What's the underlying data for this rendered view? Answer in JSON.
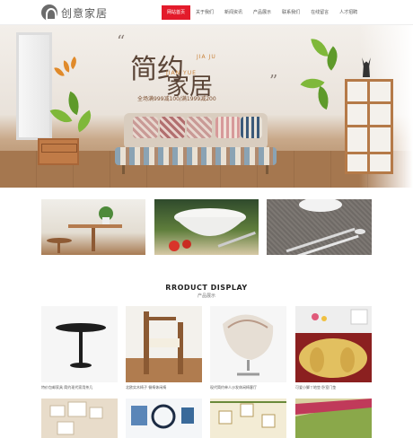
{
  "header": {
    "logo_text": "创意家居",
    "nav": [
      "网站首页",
      "关于我们",
      "新闻资讯",
      "产品展示",
      "联系我们",
      "在线留言",
      "人才招聘"
    ],
    "active_index": 0
  },
  "banner": {
    "title_1": "简约",
    "title_2": "家居",
    "sub_1": "JIA JU",
    "sub_2": "JIAN YUE",
    "promo": "全场满999减100/满1999减200",
    "quote_open": "“",
    "quote_close": "”"
  },
  "products_section": {
    "title": "RRODUCT DISPLAY",
    "subtitle": "产品展示",
    "items": [
      {
        "caption": "特价包邮家具 简约现代家用茶几"
      },
      {
        "caption": "北欧实木椅子 餐椅休闲椅"
      },
      {
        "caption": "现代简约单人沙发休闲椅客厅"
      },
      {
        "caption": "可爱小脚丫地垫 卧室门垫"
      }
    ]
  },
  "colors": {
    "accent": "#e31b2b",
    "brand_brown": "#5a4436"
  }
}
